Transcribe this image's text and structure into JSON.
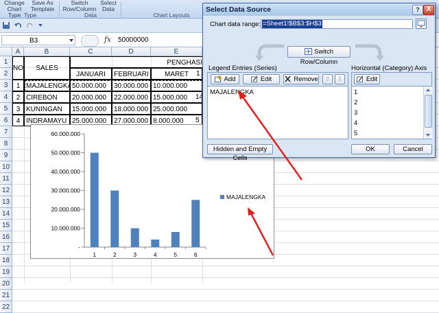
{
  "ribbon": {
    "buttons": [
      {
        "line1": "Change",
        "line2": "Chart Type"
      },
      {
        "line1": "Save As",
        "line2": "Template"
      },
      {
        "line1": "Switch",
        "line2": "Row/Column"
      },
      {
        "line1": "Select",
        "line2": "Data"
      }
    ],
    "groups": {
      "type": "Type",
      "data": "Data",
      "chart_layouts": "Chart Layouts"
    }
  },
  "formula_bar": {
    "name_box": "B3",
    "fx": "fx",
    "value": "50000000"
  },
  "sheet": {
    "columns": [
      "A",
      "B",
      "C",
      "D",
      "E"
    ],
    "rows": [
      "1",
      "2",
      "3",
      "4",
      "5",
      "6",
      "7",
      "8",
      "9",
      "10",
      "11",
      "12",
      "13",
      "14",
      "15",
      "16",
      "17",
      "18",
      "19",
      "20",
      "21",
      "22"
    ],
    "header": {
      "no": "NO",
      "sales": "SALES",
      "group": "PENGHASI",
      "months": [
        "JANUARI",
        "FEBRUARI",
        "MARET"
      ],
      "f_partial": "1"
    },
    "data": [
      {
        "no": "1",
        "sales": "MAJALENGKA",
        "jan": "50.000.000",
        "feb": "30.000.000",
        "mar": "10.000.000",
        "f": ""
      },
      {
        "no": "2",
        "sales": "CIREBON",
        "jan": "20.000.000",
        "feb": "22.000.000",
        "mar": "15.000.000",
        "f": "14"
      },
      {
        "no": "3",
        "sales": "KUNINGAN",
        "jan": "15.000.000",
        "feb": "18.000.000",
        "mar": "25.000.000",
        "f": ""
      },
      {
        "no": "4",
        "sales": "INDRAMAYU",
        "jan": "25.000.000",
        "feb": "27.000.000",
        "mar": "8.000.000",
        "f": "5"
      }
    ]
  },
  "chart_data": {
    "type": "bar",
    "categories": [
      "1",
      "2",
      "3",
      "4",
      "5",
      "6"
    ],
    "series": [
      {
        "name": "MAJALENGKA",
        "values": [
          50000000,
          30000000,
          10000000,
          4000000,
          8000000,
          25000000
        ]
      }
    ],
    "y_tick_labels": [
      "-",
      "10.000.000",
      "20.000.000",
      "30.000.000",
      "40.000.000",
      "50.000.000",
      "60.000.000"
    ],
    "ylim": [
      0,
      60000000
    ],
    "legend": "right",
    "grid": false,
    "bar_color": "#4f81bd"
  },
  "dialog": {
    "title": "Select Data Source",
    "help": "?",
    "close": "X",
    "range_label": "Chart data range:",
    "range_value": "=Sheet1!$B$3:$H$3",
    "switch_label": "Switch Row/Column",
    "legend_title": "Legend Entries (Series)",
    "add_label": "Add",
    "edit_label": "Edit",
    "remove_label": "Remove",
    "up_arrow": "⇧",
    "down_arrow": "⇩",
    "legend_items": [
      "MAJALENGKA"
    ],
    "axis_title": "Horizontal (Category) Axis Labels",
    "axis_edit_label": "Edit",
    "axis_items": [
      "1",
      "2",
      "3",
      "4",
      "5"
    ],
    "hidden_cells_label": "Hidden and Empty Cells",
    "ok_label": "OK",
    "cancel_label": "Cancel"
  },
  "colors": {
    "arrow": "#e0201c",
    "dialog_bg": "#dbe6f4",
    "title_bg": "#a9c6ea"
  }
}
